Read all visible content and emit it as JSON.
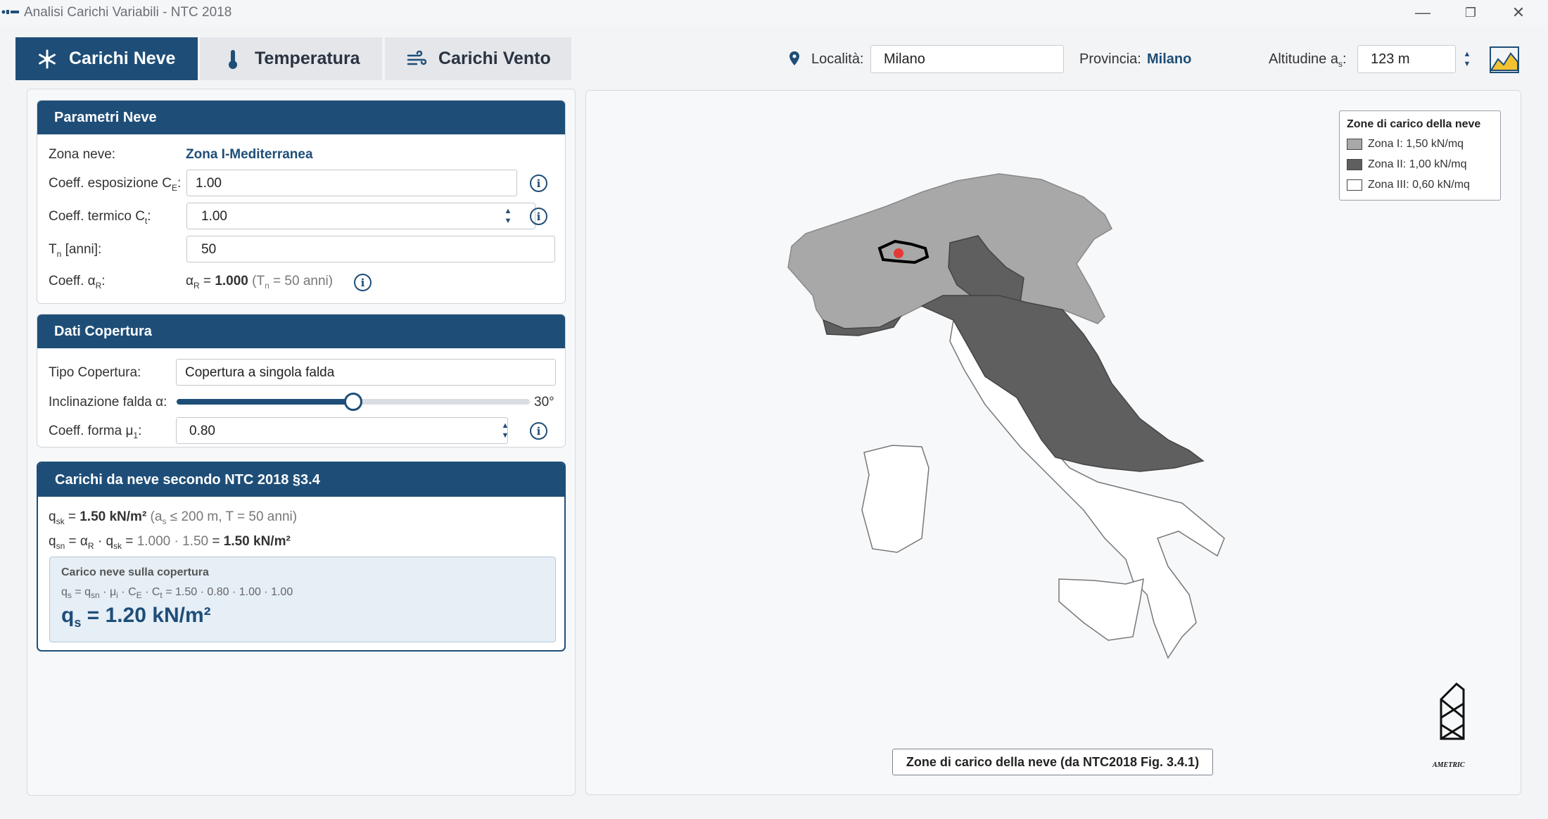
{
  "window": {
    "title": "Analisi Carichi Variabili - NTC 2018",
    "minimize": "—",
    "restore": "❐",
    "close": "✕"
  },
  "tabs": [
    {
      "label": "Carichi Neve",
      "icon": "snowflake-icon",
      "active": true
    },
    {
      "label": "Temperatura",
      "icon": "thermometer-icon",
      "active": false
    },
    {
      "label": "Carichi Vento",
      "icon": "wind-icon",
      "active": false
    }
  ],
  "header": {
    "localita_label": "Località:",
    "localita_value": "Milano",
    "provincia_label": "Provincia:",
    "provincia_value": "Milano",
    "altitudine_label_main": "Altitudine a",
    "altitudine_label_sub": "s",
    "altitudine_label_colon": ":",
    "altitudine_value": "123 m"
  },
  "neve": {
    "title": "Parametri Neve",
    "zona_label": "Zona neve:",
    "zona_value": "Zona I-Mediterranea",
    "ce_label_main": "Coeff. esposizione C",
    "ce_label_sub": "E",
    "ce_label_colon": ":",
    "ce_value": "1.00",
    "ct_label_main": "Coeff. termico C",
    "ct_label_sub": "t",
    "ct_label_colon": ":",
    "ct_value": "1.00",
    "tn_label_main": "T",
    "tn_label_sub": "n",
    "tn_label_rest": " [anni]:",
    "tn_value": "50",
    "ar_label_main": "Coeff. α",
    "ar_label_sub": "R",
    "ar_label_colon": ":",
    "ar_expr_a": "α",
    "ar_expr_sub": "R",
    "ar_expr_eq": " = ",
    "ar_expr_val": "1.000",
    "ar_expr_note_open": " (T",
    "ar_expr_note_sub": "n",
    "ar_expr_note_close": " = 50 anni)"
  },
  "copertura": {
    "title": "Dati Copertura",
    "tipo_label": "Tipo Copertura:",
    "tipo_value": "Copertura a singola falda",
    "incl_label": "Inclinazione falda α:",
    "incl_value": "30°",
    "incl_fraction": 0.5,
    "mu_label_main": "Coeff. forma μ",
    "mu_label_sub": "1",
    "mu_label_colon": ":",
    "mu_value": "0.80"
  },
  "carichi": {
    "title": "Carichi da neve secondo NTC 2018 §3.4",
    "qsk_q": "q",
    "qsk_sub": "sk",
    "qsk_eq": " = ",
    "qsk_val": "1.50 kN/m²",
    "qsk_note_open": " (a",
    "qsk_note_sub": "s",
    "qsk_note_close": " ≤ 200 m, T = 50 anni)",
    "qsn_q": "q",
    "qsn_sub": "sn",
    "qsn_eq1": " = α",
    "qsn_sub2": "R",
    "qsn_dot": " · q",
    "qsn_sub3": "sk",
    "qsn_eq2": " = ",
    "qsn_calc": "1.000 · 1.50",
    "qsn_eq3": " = ",
    "qsn_val": "1.50 kN/m²",
    "box_title": "Carico neve sulla copertura",
    "box_f1": "q",
    "box_f1_sub": "s",
    "box_f2": " = q",
    "box_f2_sub": "sn",
    "box_f3": " · μ",
    "box_f3_sub": "i",
    "box_f4": " · C",
    "box_f4_sub": "E",
    "box_f5": " · C",
    "box_f5_sub": "t",
    "box_f6": " = 1.50 · 0.80 · 1.00 · 1.00",
    "result_q": "q",
    "result_sub": "s",
    "result_val": " = 1.20 kN/m²"
  },
  "map": {
    "legend_title": "Zone di carico della neve",
    "legend": [
      {
        "label": "Zona I: 1,50 kN/mq",
        "color": "#a8a8a8"
      },
      {
        "label": "Zona II: 1,00 kN/mq",
        "color": "#5f5f5f"
      },
      {
        "label": "Zona III: 0,60 kN/mq",
        "color": "#ffffff"
      }
    ],
    "caption": "Zone di carico della neve (da NTC2018 Fig. 3.4.1)",
    "logo_text": "AMETRIC",
    "colors": {
      "zona1": "#a8a8a8",
      "zona2": "#5f5f5f",
      "zona3": "#ffffff",
      "marker": "#e53935"
    }
  }
}
